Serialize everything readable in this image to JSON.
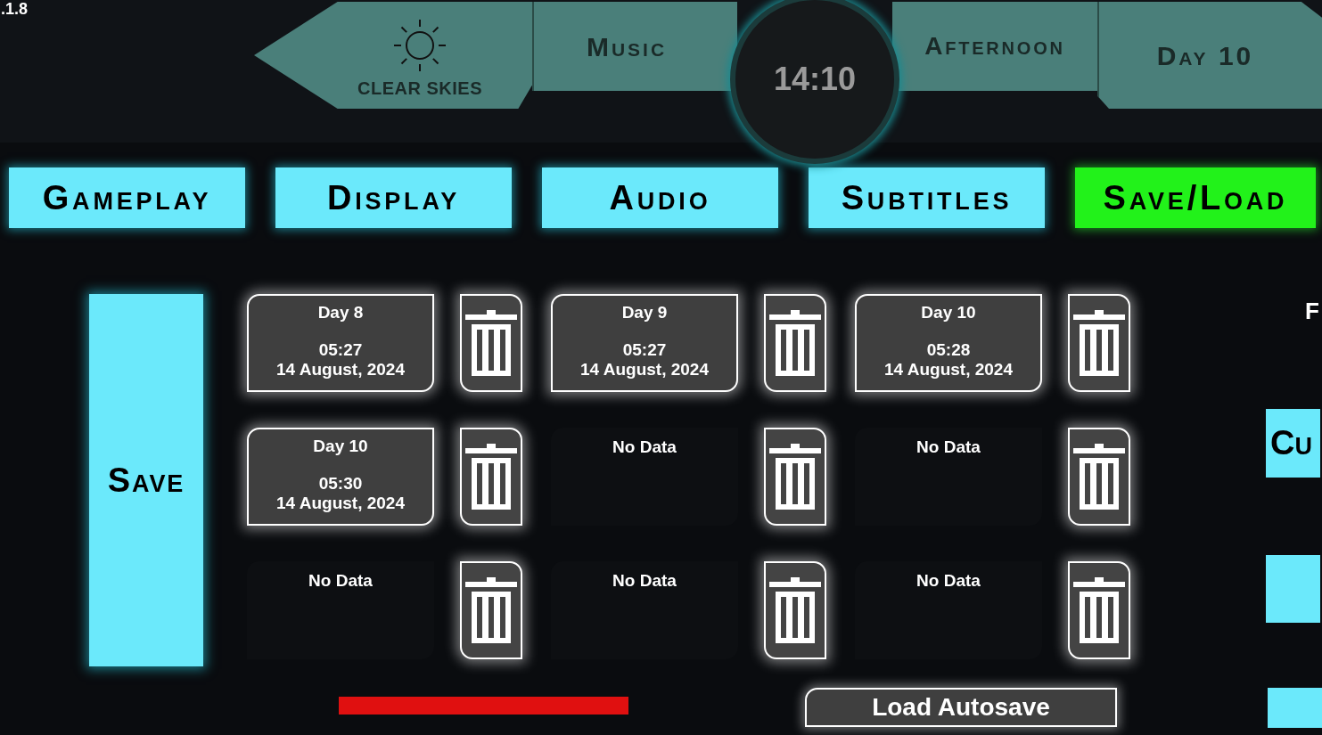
{
  "version": ".1.8",
  "status_bar": {
    "weather": "CLEAR SKIES",
    "music": "Music",
    "clock": "14:10",
    "period": "Afternoon",
    "day": "Day 10"
  },
  "tabs": [
    {
      "label": "Gameplay",
      "selected": false
    },
    {
      "label": "Display",
      "selected": false
    },
    {
      "label": "Audio",
      "selected": false
    },
    {
      "label": "Subtitles",
      "selected": false
    },
    {
      "label": "Save/Load",
      "selected": true
    }
  ],
  "mode_button": "Save",
  "slots": [
    {
      "kind": "saved",
      "day": "Day 8",
      "time": "05:27",
      "date": "14 August, 2024"
    },
    {
      "kind": "saved",
      "day": "Day 9",
      "time": "05:27",
      "date": "14 August, 2024"
    },
    {
      "kind": "saved",
      "day": "Day 10",
      "time": "05:28",
      "date": "14 August, 2024"
    },
    {
      "kind": "saved",
      "day": "Day 10",
      "time": "05:30",
      "date": "14 August, 2024"
    },
    {
      "kind": "empty",
      "label": "No Data"
    },
    {
      "kind": "empty",
      "label": "No Data"
    },
    {
      "kind": "empty",
      "label": "No Data"
    },
    {
      "kind": "empty",
      "label": "No Data"
    },
    {
      "kind": "empty",
      "label": "No Data"
    }
  ],
  "side_panel": {
    "heading": "F",
    "button": "Cu"
  },
  "load_autosave": "Load Autosave"
}
